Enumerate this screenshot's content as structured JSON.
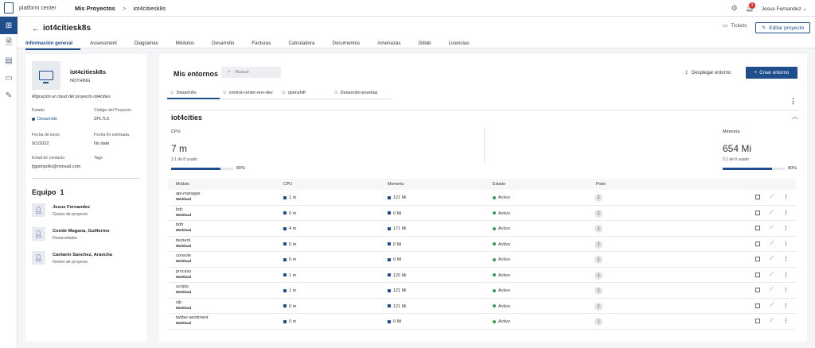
{
  "topbar": {
    "platform": "platform center",
    "breadcrumb_root": "Mis Proyectos",
    "breadcrumb_sep": ">",
    "breadcrumb_current": "iot4citiesk8s",
    "notifications": "3",
    "user": "Jesus Fernandez"
  },
  "project": {
    "title": "iot4citiesk8s",
    "tickets_label": "Tickets",
    "edit_label": "Editar proyecto",
    "tabs": [
      "Información general",
      "Assessment",
      "Diagramas",
      "Módulos",
      "Desarrollo",
      "Facturas",
      "Calculadora",
      "Documentos",
      "Amenazas",
      "Gitlab",
      "Licencias"
    ]
  },
  "info": {
    "name": "iot4citiesk8s",
    "subtitle": "NOTHING",
    "description": "Migración al cloud del proyecto iot4cities",
    "estado_label": "Estado",
    "estado_value": "Desarrollo",
    "codigo_label": "Código del Proyecto",
    "codigo_value": "ZPL7L5",
    "inicio_label": "Fecha de inicio",
    "inicio_value": "9/1/2022",
    "fin_label": "Fecha fin estimada",
    "fin_value": "No date",
    "email_label": "Email de contacto",
    "email_value": "jfgpimpollo@minsait.com",
    "tags_label": "Tags"
  },
  "team": {
    "title": "Equipo",
    "count": "1",
    "members": [
      {
        "name": "Jesus Fernandez",
        "role": "Gestor de proyecto"
      },
      {
        "name": "Conde Magana, Guillermo",
        "role": "Desarrollador"
      },
      {
        "name": "Cantarin Sanchez, Arancha",
        "role": "Gestor de proyecto"
      }
    ]
  },
  "environments": {
    "title": "Mis entornos",
    "search_placeholder": "Buscar",
    "deploy_label": "Desplegar entorno",
    "create_label": "Crear entorno",
    "tabs": [
      "Desarrollo",
      "control-center-env-dev",
      "openshift",
      "Desarrollo-pruebas"
    ],
    "section_title": "iot4cities",
    "cpu": {
      "label": "CPU",
      "value": "7 m",
      "used": "3.1 de 8 usado",
      "percent_label": "80%",
      "fill": 0.8
    },
    "memory": {
      "label": "Memoria",
      "value": "654 Mi",
      "used": "3.1 de 8 usado",
      "percent_label": "80%",
      "fill": 0.8
    }
  },
  "table": {
    "headers": [
      "Módulo",
      "CPU",
      "Memoria",
      "Estado",
      "Pods"
    ],
    "rows": [
      {
        "name": "api-manager",
        "type": "Workload",
        "cpu": "1 m",
        "mem": "121 Mi",
        "status": "Activo",
        "pods": "1"
      },
      {
        "name": "bdc",
        "type": "Workload",
        "cpu": "0 m",
        "mem": "0 Mi",
        "status": "Activo",
        "pods": "1"
      },
      {
        "name": "bdtr",
        "type": "Workload",
        "cpu": "4 m",
        "mem": "171 Mi",
        "status": "Activo",
        "pods": "1"
      },
      {
        "name": "biorient",
        "type": "Workload",
        "cpu": "0 m",
        "mem": "0 Mi",
        "status": "Activo",
        "pods": "1"
      },
      {
        "name": "console",
        "type": "Workload",
        "cpu": "0 m",
        "mem": "0 Mi",
        "status": "Activo",
        "pods": "1"
      },
      {
        "name": "process",
        "type": "Workload",
        "cpu": "1 m",
        "mem": "120 Mi",
        "status": "Activo",
        "pods": "1"
      },
      {
        "name": "scripts",
        "type": "Workload",
        "cpu": "1 m",
        "mem": "121 Mi",
        "status": "Activo",
        "pods": "1"
      },
      {
        "name": "sib",
        "type": "Workload",
        "cpu": "0 m",
        "mem": "121 Mi",
        "status": "Activo",
        "pods": "1"
      },
      {
        "name": "twitter-sentiment",
        "type": "Workload",
        "cpu": "0 m",
        "mem": "0 Mi",
        "status": "Activo",
        "pods": "1"
      }
    ]
  },
  "colors": {
    "accent": "#1f4e8c",
    "active": "#2e9e4f",
    "developing": "#1f4e8c"
  }
}
